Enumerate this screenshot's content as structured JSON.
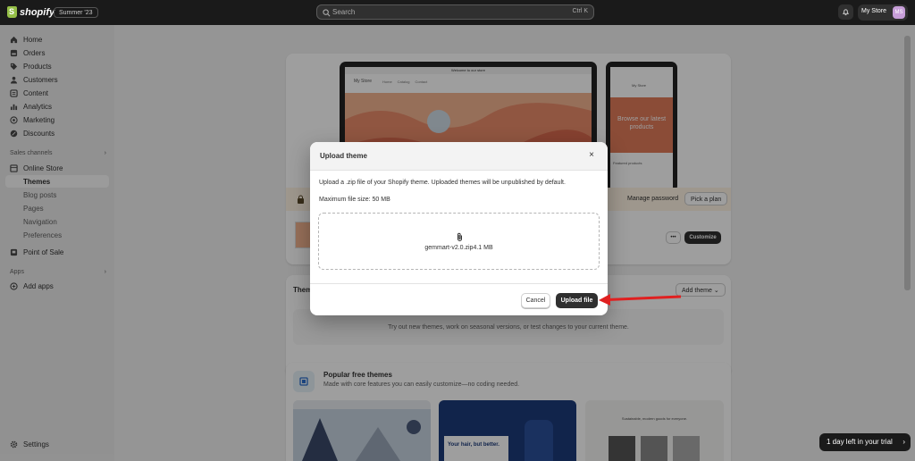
{
  "topbar": {
    "brand": "shopify",
    "edition": "Summer '23",
    "search_placeholder": "Search",
    "search_shortcut": "Ctrl K",
    "store_name": "My Store",
    "avatar_initials": "MS"
  },
  "sidebar": {
    "items": [
      {
        "label": "Home",
        "icon": "home-icon"
      },
      {
        "label": "Orders",
        "icon": "orders-icon"
      },
      {
        "label": "Products",
        "icon": "tag-icon"
      },
      {
        "label": "Customers",
        "icon": "person-icon"
      },
      {
        "label": "Content",
        "icon": "content-icon"
      },
      {
        "label": "Analytics",
        "icon": "chart-icon"
      },
      {
        "label": "Marketing",
        "icon": "target-icon"
      },
      {
        "label": "Discounts",
        "icon": "discount-icon"
      }
    ],
    "sales_channels_heading": "Sales channels",
    "online_store": "Online Store",
    "online_store_sub": [
      "Themes",
      "Blog posts",
      "Pages",
      "Navigation",
      "Preferences"
    ],
    "point_of_sale": "Point of Sale",
    "apps_heading": "Apps",
    "add_apps": "Add apps",
    "settings": "Settings"
  },
  "preview": {
    "banner": "Welcome to our store",
    "store_title": "My Store",
    "nav": [
      "Home",
      "Catalog",
      "Contact"
    ],
    "mobile_heading": "Browse our latest products",
    "mobile_featured": "Featured products"
  },
  "password_bar": {
    "manage_password": "Manage password",
    "pick_plan": "Pick a plan"
  },
  "current_theme": {
    "more_label": "•••",
    "customize_label": "Customize"
  },
  "theme_library": {
    "heading": "Theme library",
    "add_theme": "Add theme",
    "empty_text": "Try out new themes, work on seasonal versions, or test changes to your current theme."
  },
  "popular": {
    "heading": "Popular free themes",
    "subtext": "Made with core features you can easily customize—no coding needed.",
    "card2_heading": "Your hair, but better.",
    "card3_heading": "Sustainable, modern goods for everyone."
  },
  "modal": {
    "title": "Upload theme",
    "close": "×",
    "description": "Upload a .zip file of your Shopify theme. Uploaded themes will be unpublished by default.",
    "max_size": "Maximum file size: 50 MB",
    "file_name": "gemmart-v2.0.zip4.1 MB",
    "cancel": "Cancel",
    "upload": "Upload file"
  },
  "trial": "1 day left in your trial",
  "colors": {
    "topbar": "#1a1a1a",
    "sidebar": "#ebebeb",
    "primary_button": "#303030",
    "arrow": "#e02020",
    "password_bar": "#fff4e4"
  }
}
